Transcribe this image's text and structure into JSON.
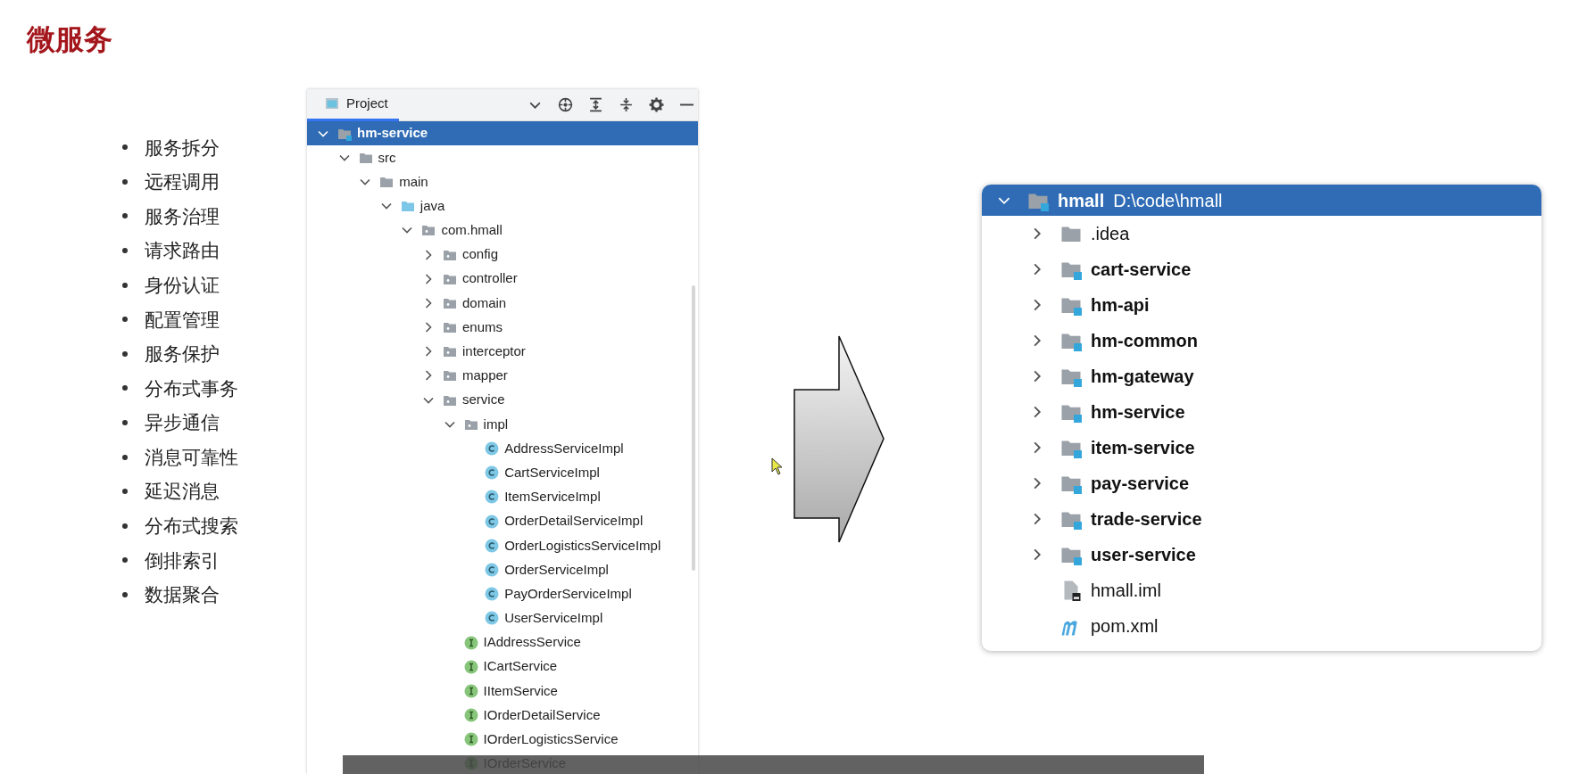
{
  "slide": {
    "title": "微服务"
  },
  "topics": [
    "服务拆分",
    "远程调用",
    "服务治理",
    "请求路由",
    "身份认证",
    "配置管理",
    "服务保护",
    "分布式事务",
    "异步通信",
    "消息可靠性",
    "延迟消息",
    "分布式搜索",
    "倒排索引",
    "数据聚合"
  ],
  "project_panel": {
    "tab": {
      "label": "Project",
      "selected": true
    },
    "tree": [
      {
        "label": "hm-service",
        "kind": "module",
        "expanded": true,
        "selected": true,
        "children": [
          {
            "label": "src",
            "kind": "folder",
            "expanded": true,
            "selected": false,
            "children": [
              {
                "label": "main",
                "kind": "folder",
                "expanded": true,
                "selected": false,
                "children": [
                  {
                    "label": "java",
                    "kind": "source-folder",
                    "expanded": true,
                    "selected": false,
                    "children": [
                      {
                        "label": "com.hmall",
                        "kind": "package",
                        "expanded": true,
                        "selected": false,
                        "children": [
                          {
                            "label": "config",
                            "kind": "package",
                            "expanded": false,
                            "selected": false
                          },
                          {
                            "label": "controller",
                            "kind": "package",
                            "expanded": false,
                            "selected": false
                          },
                          {
                            "label": "domain",
                            "kind": "package",
                            "expanded": false,
                            "selected": false
                          },
                          {
                            "label": "enums",
                            "kind": "package",
                            "expanded": false,
                            "selected": false
                          },
                          {
                            "label": "interceptor",
                            "kind": "package",
                            "expanded": false,
                            "selected": false
                          },
                          {
                            "label": "mapper",
                            "kind": "package",
                            "expanded": false,
                            "selected": false
                          },
                          {
                            "label": "service",
                            "kind": "package",
                            "expanded": true,
                            "selected": false,
                            "children": [
                              {
                                "label": "impl",
                                "kind": "package",
                                "expanded": true,
                                "selected": false,
                                "children": [
                                  {
                                    "label": "AddressServiceImpl",
                                    "kind": "class",
                                    "selected": false
                                  },
                                  {
                                    "label": "CartServiceImpl",
                                    "kind": "class",
                                    "selected": false
                                  },
                                  {
                                    "label": "ItemServiceImpl",
                                    "kind": "class",
                                    "selected": false
                                  },
                                  {
                                    "label": "OrderDetailServiceImpl",
                                    "kind": "class",
                                    "selected": false
                                  },
                                  {
                                    "label": "OrderLogisticsServiceImpl",
                                    "kind": "class",
                                    "selected": false
                                  },
                                  {
                                    "label": "OrderServiceImpl",
                                    "kind": "class",
                                    "selected": false
                                  },
                                  {
                                    "label": "PayOrderServiceImpl",
                                    "kind": "class",
                                    "selected": false
                                  },
                                  {
                                    "label": "UserServiceImpl",
                                    "kind": "class",
                                    "selected": false
                                  }
                                ]
                              },
                              {
                                "label": "IAddressService",
                                "kind": "interface",
                                "selected": false
                              },
                              {
                                "label": "ICartService",
                                "kind": "interface",
                                "selected": false
                              },
                              {
                                "label": "IItemService",
                                "kind": "interface",
                                "selected": false
                              },
                              {
                                "label": "IOrderDetailService",
                                "kind": "interface",
                                "selected": false
                              },
                              {
                                "label": "IOrderLogisticsService",
                                "kind": "interface",
                                "selected": false
                              },
                              {
                                "label": "IOrderService",
                                "kind": "interface",
                                "selected": false
                              }
                            ]
                          }
                        ]
                      }
                    ]
                  }
                ]
              }
            ]
          }
        ]
      }
    ]
  },
  "module_panel": {
    "tree": [
      {
        "label": "hmall",
        "path": "D:\\code\\hmall",
        "kind": "module",
        "expanded": true,
        "selected": true,
        "children": [
          {
            "label": ".idea",
            "kind": "folder",
            "expanded": false,
            "selected": false
          },
          {
            "label": "cart-service",
            "kind": "module",
            "expanded": false,
            "selected": false
          },
          {
            "label": "hm-api",
            "kind": "module",
            "expanded": false,
            "selected": false
          },
          {
            "label": "hm-common",
            "kind": "module",
            "expanded": false,
            "selected": false
          },
          {
            "label": "hm-gateway",
            "kind": "module",
            "expanded": false,
            "selected": false
          },
          {
            "label": "hm-service",
            "kind": "module",
            "expanded": false,
            "selected": false
          },
          {
            "label": "item-service",
            "kind": "module",
            "expanded": false,
            "selected": false
          },
          {
            "label": "pay-service",
            "kind": "module",
            "expanded": false,
            "selected": false
          },
          {
            "label": "trade-service",
            "kind": "module",
            "expanded": false,
            "selected": false
          },
          {
            "label": "user-service",
            "kind": "module",
            "expanded": false,
            "selected": false
          },
          {
            "label": "hmall.iml",
            "kind": "file",
            "selected": false
          },
          {
            "label": "pom.xml",
            "kind": "maven",
            "selected": false
          }
        ]
      }
    ]
  }
}
